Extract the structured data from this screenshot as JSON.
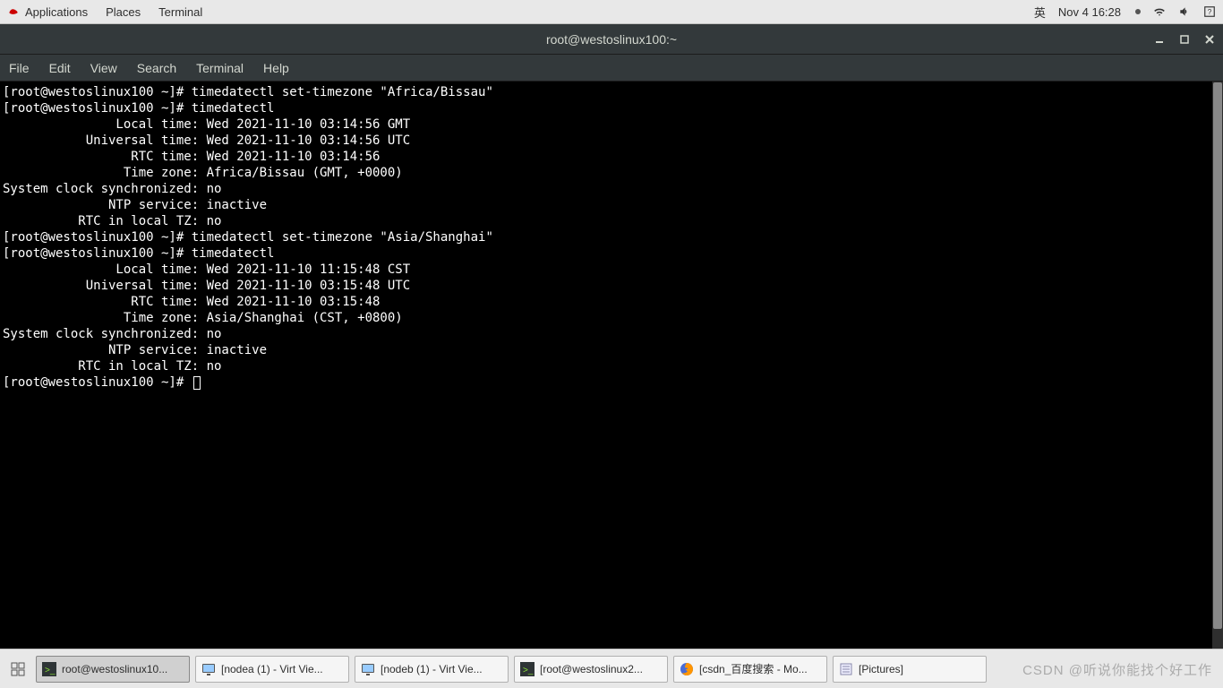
{
  "topbar": {
    "apps": "Applications",
    "places": "Places",
    "term": "Terminal",
    "ime": "英",
    "clock": "Nov 4  16:28"
  },
  "window": {
    "title": "root@westoslinux100:~"
  },
  "menu": {
    "file": "File",
    "edit": "Edit",
    "view": "View",
    "search": "Search",
    "terminal": "Terminal",
    "help": "Help"
  },
  "terminal": {
    "lines": [
      "[root@westoslinux100 ~]# timedatectl set-timezone \"Africa/Bissau\"",
      "[root@westoslinux100 ~]# timedatectl",
      "               Local time: Wed 2021-11-10 03:14:56 GMT",
      "           Universal time: Wed 2021-11-10 03:14:56 UTC",
      "                 RTC time: Wed 2021-11-10 03:14:56",
      "                Time zone: Africa/Bissau (GMT, +0000)",
      "System clock synchronized: no",
      "              NTP service: inactive",
      "          RTC in local TZ: no",
      "[root@westoslinux100 ~]# timedatectl set-timezone \"Asia/Shanghai\"",
      "[root@westoslinux100 ~]# timedatectl",
      "               Local time: Wed 2021-11-10 11:15:48 CST",
      "           Universal time: Wed 2021-11-10 03:15:48 UTC",
      "                 RTC time: Wed 2021-11-10 03:15:48",
      "                Time zone: Asia/Shanghai (CST, +0800)",
      "System clock synchronized: no",
      "              NTP service: inactive",
      "          RTC in local TZ: no"
    ],
    "prompt": "[root@westoslinux100 ~]# "
  },
  "taskbar": {
    "items": [
      {
        "label": "root@westoslinux10...",
        "icon": "terminal",
        "active": true
      },
      {
        "label": "[nodea (1) - Virt Vie...",
        "icon": "monitor",
        "active": false
      },
      {
        "label": "[nodeb (1) - Virt Vie...",
        "icon": "monitor",
        "active": false
      },
      {
        "label": "[root@westoslinux2...",
        "icon": "terminal",
        "active": false
      },
      {
        "label": "[csdn_百度搜索 - Mo...",
        "icon": "firefox",
        "active": false
      },
      {
        "label": "[Pictures]",
        "icon": "files",
        "active": false
      }
    ]
  },
  "watermark": "CSDN @听说你能找个好工作"
}
